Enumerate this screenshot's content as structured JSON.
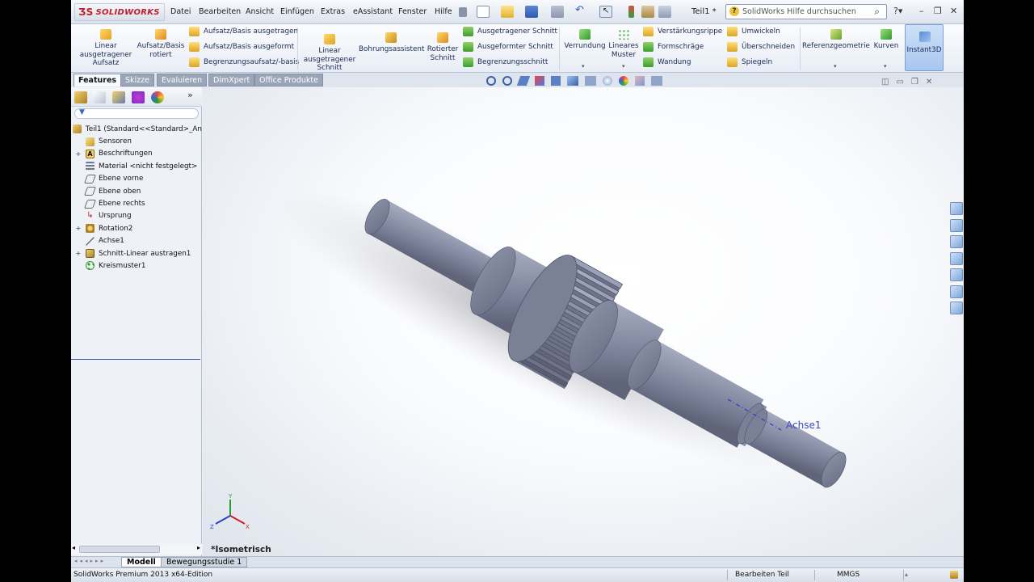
{
  "app": {
    "logo_text": "SOLIDWORKS",
    "document_title": "Teil1 *",
    "search_placeholder": "SolidWorks Hilfe durchsuchen"
  },
  "menu": [
    "Datei",
    "Bearbeiten",
    "Ansicht",
    "Einfügen",
    "Extras",
    "eAssistant",
    "Fenster",
    "Hilfe"
  ],
  "ribbon": {
    "big": [
      {
        "label": "Linear ausgetragener Aufsatz",
        "lines": [
          "Linear",
          "ausgetragener",
          "Aufsatz"
        ],
        "icon": "extruded-boss-icon"
      },
      {
        "label": "Aufsatz/Basis rotiert",
        "lines": [
          "Aufsatz/Basis",
          "rotiert"
        ],
        "icon": "revolved-boss-icon"
      },
      {
        "label": "Linear ausgetragener Schnitt",
        "lines": [
          "Linear",
          "ausgetragener",
          "Schnitt"
        ],
        "icon": "extruded-cut-icon"
      },
      {
        "label": "Bohrungsassistent",
        "lines": [
          "Bohrungsassistent"
        ],
        "icon": "hole-wizard-icon"
      },
      {
        "label": "Rotierter Schnitt",
        "lines": [
          "Rotierter",
          "Schnitt"
        ],
        "icon": "revolved-cut-icon"
      },
      {
        "label": "Verrundung",
        "lines": [
          "Verrundung"
        ],
        "icon": "fillet-icon"
      },
      {
        "label": "Lineares Muster",
        "lines": [
          "Lineares",
          "Muster"
        ],
        "icon": "linear-pattern-icon"
      },
      {
        "label": "Referenzgeometrie",
        "lines": [
          "Referenzgeometrie"
        ],
        "icon": "reference-geometry-icon"
      },
      {
        "label": "Kurven",
        "lines": [
          "Kurven"
        ],
        "icon": "curves-icon"
      }
    ],
    "group1": [
      "Aufsatz/Basis ausgetragen",
      "Aufsatz/Basis ausgeformt",
      "Begrenzungsaufsatz/-basis"
    ],
    "group2": [
      "Ausgetragener Schnitt",
      "Ausgeformter Schnitt",
      "Begrenzungsschnitt"
    ],
    "group3": [
      "Verstärkungsrippe",
      "Formschräge",
      "Wandung"
    ],
    "group4": [
      "Umwickeln",
      "Überschneiden",
      "Spiegeln"
    ],
    "instant3d": "Instant3D"
  },
  "tabs": [
    "Features",
    "Skizze",
    "Evaluieren",
    "DimXpert",
    "Office Produkte"
  ],
  "tree": [
    {
      "label": "Teil1  (Standard<<Standard>_An",
      "icon": "part-icon",
      "expand": ""
    },
    {
      "label": "Sensoren",
      "icon": "sensor-icon",
      "expand": ""
    },
    {
      "label": "Beschriftungen",
      "icon": "annotations-icon",
      "expand": "+"
    },
    {
      "label": "Material <nicht festgelegt>",
      "icon": "material-icon",
      "expand": ""
    },
    {
      "label": "Ebene vorne",
      "icon": "plane-icon",
      "expand": ""
    },
    {
      "label": "Ebene oben",
      "icon": "plane-icon",
      "expand": ""
    },
    {
      "label": "Ebene rechts",
      "icon": "plane-icon",
      "expand": ""
    },
    {
      "label": "Ursprung",
      "icon": "origin-icon",
      "expand": ""
    },
    {
      "label": "Rotation2",
      "icon": "revolve-feature-icon",
      "expand": "+"
    },
    {
      "label": "Achse1",
      "icon": "axis-icon",
      "expand": ""
    },
    {
      "label": "Schnitt-Linear austragen1",
      "icon": "cut-extrude-feature-icon",
      "expand": "+"
    },
    {
      "label": "Kreismuster1",
      "icon": "circular-pattern-icon",
      "expand": ""
    }
  ],
  "viewport": {
    "view_label": "*Isometrisch",
    "axis_label": "Achse1"
  },
  "bottom_tabs": [
    "Modell",
    "Bewegungsstudie 1"
  ],
  "status": {
    "product": "SolidWorks Premium 2013 x64-Edition",
    "mode": "Bearbeiten Teil",
    "units": "MMGS"
  },
  "colors": {
    "model": "#8c92a8",
    "accent": "#3a5fa8",
    "axis_line": "#3344cc"
  }
}
